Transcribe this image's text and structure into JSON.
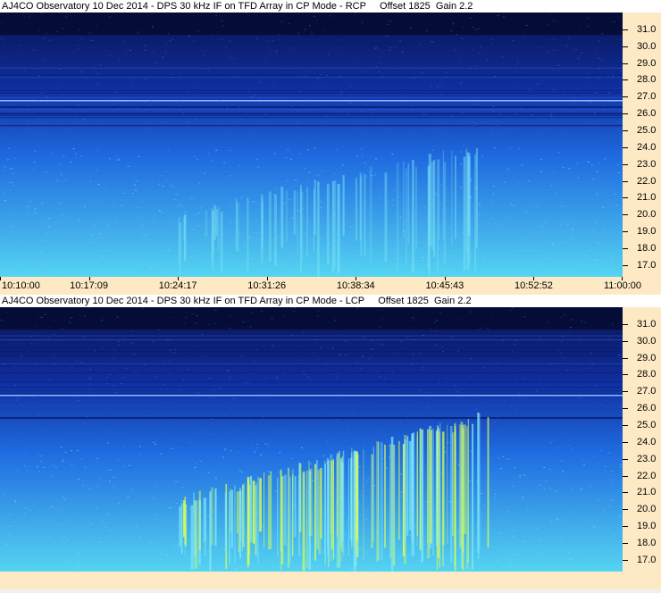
{
  "chart_data": [
    {
      "type": "heatmap",
      "title": "AJ4CO Observatory 10 Dec 2014 - DPS 30 kHz IF on TFD Array in CP Mode - RCP     Offset 1825  Gain 2.2",
      "ylim": [
        16.3,
        32.0
      ],
      "yticks": [
        "31.0",
        "30.0",
        "29.0",
        "28.0",
        "27.0",
        "26.0",
        "25.0",
        "24.0",
        "23.0",
        "22.0",
        "21.0",
        "20.0",
        "19.0",
        "18.0",
        "17.0"
      ],
      "xticks": [
        "10:10:00",
        "10:17:09",
        "10:24:17",
        "10:31:26",
        "10:38:34",
        "10:45:43",
        "10:52:52",
        "11:00:00"
      ],
      "colors": {
        "low": "#0a1450",
        "mid": "#1f6be0",
        "high": "#55d4f2",
        "burst": "#d6ff5a"
      }
    },
    {
      "type": "heatmap",
      "title": "AJ4CO Observatory 10 Dec 2014 - DPS 30 kHz IF on TFD Array in CP Mode - LCP     Offset 1825  Gain 2.2",
      "ylim": [
        16.3,
        32.0
      ],
      "yticks": [
        "31.0",
        "30.0",
        "29.0",
        "28.0",
        "27.0",
        "26.0",
        "25.0",
        "24.0",
        "23.0",
        "22.0",
        "21.0",
        "20.0",
        "19.0",
        "18.0",
        "17.0"
      ],
      "xticks": [],
      "colors": {
        "low": "#0a1450",
        "mid": "#1f6be0",
        "high": "#55d4f2",
        "burst": "#d6ff5a"
      }
    }
  ]
}
